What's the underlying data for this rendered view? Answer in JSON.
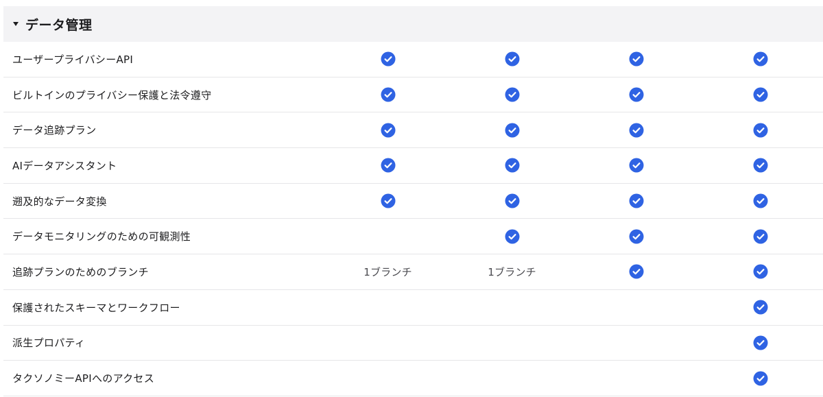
{
  "section": {
    "title": "データ管理",
    "icon": "caret-down-icon"
  },
  "accent_color": "#2f63e3",
  "rows": [
    {
      "label": "ユーザープライバシーAPI",
      "cells": [
        true,
        true,
        true,
        true
      ]
    },
    {
      "label": "ビルトインのプライバシー保護と法令遵守",
      "cells": [
        true,
        true,
        true,
        true
      ]
    },
    {
      "label": "データ追跡プラン",
      "cells": [
        true,
        true,
        true,
        true
      ]
    },
    {
      "label": "AIデータアシスタント",
      "cells": [
        true,
        true,
        true,
        true
      ]
    },
    {
      "label": "遡及的なデータ変換",
      "cells": [
        true,
        true,
        true,
        true
      ]
    },
    {
      "label": "データモニタリングのための可観測性",
      "cells": [
        false,
        true,
        true,
        true
      ]
    },
    {
      "label": "追跡プランのためのブランチ",
      "cells": [
        "1ブランチ",
        "1ブランチ",
        true,
        true
      ]
    },
    {
      "label": "保護されたスキーマとワークフロー",
      "cells": [
        false,
        false,
        false,
        true
      ]
    },
    {
      "label": "派生プロパティ",
      "cells": [
        false,
        false,
        false,
        true
      ]
    },
    {
      "label": "タクソノミーAPIへのアクセス",
      "cells": [
        false,
        false,
        false,
        true
      ]
    }
  ]
}
